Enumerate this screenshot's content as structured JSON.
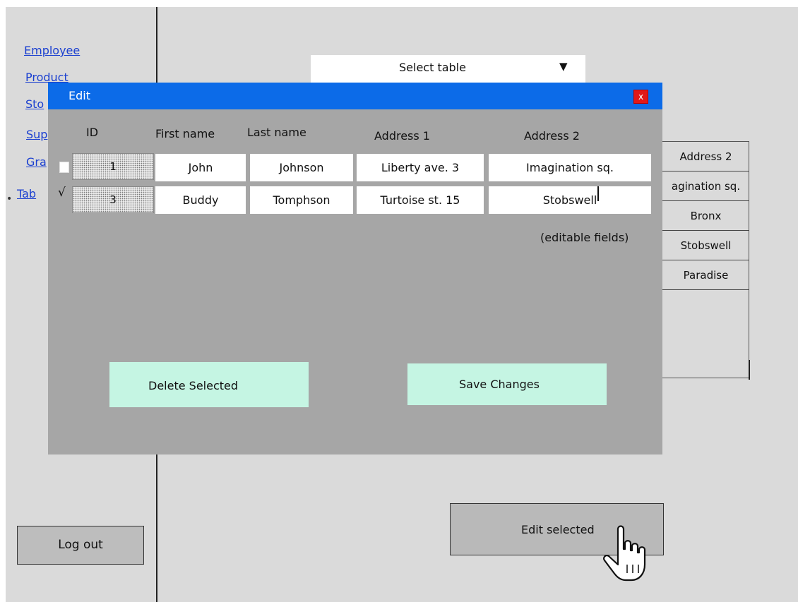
{
  "sidebar": {
    "items": [
      {
        "label": "Employee"
      },
      {
        "label": "Product"
      },
      {
        "label": "Sto"
      },
      {
        "label": "Sup"
      },
      {
        "label": "Gra"
      },
      {
        "label": "Tab"
      }
    ],
    "bullet": "•"
  },
  "select_table": {
    "label": "Select table",
    "arrow": "▼"
  },
  "background_table": {
    "cells": [
      "Address 2",
      "agination sq.",
      "Bronx",
      "Stobswell",
      "Paradise"
    ]
  },
  "logout_button": {
    "label": "Log out"
  },
  "edit_selected_button": {
    "label": "Edit selected"
  },
  "edit_dialog": {
    "title": "Edit",
    "close_label": "x",
    "columns": [
      "ID",
      "First name",
      "Last name",
      "Address 1",
      "Address 2"
    ],
    "rows": [
      {
        "checked": false,
        "id": "1",
        "first_name": "John",
        "last_name": "Johnson",
        "address1": "Liberty ave. 3",
        "address2": "Imagination sq."
      },
      {
        "checked": true,
        "check_mark": "√",
        "id": "3",
        "first_name": "Buddy",
        "last_name": "Tomphson",
        "address1": "Turtoise st. 15",
        "address2": "Stobswell"
      }
    ],
    "note": "(editable fields)",
    "delete_button": {
      "label": "Delete Selected"
    },
    "save_button": {
      "label": "Save Changes"
    }
  },
  "colors": {
    "titlebar": "#0c6be8",
    "close": "#e01818",
    "dialog_bg": "#a6a6a6",
    "action_button": "#c5f5e3",
    "link": "#1a3fd0"
  }
}
